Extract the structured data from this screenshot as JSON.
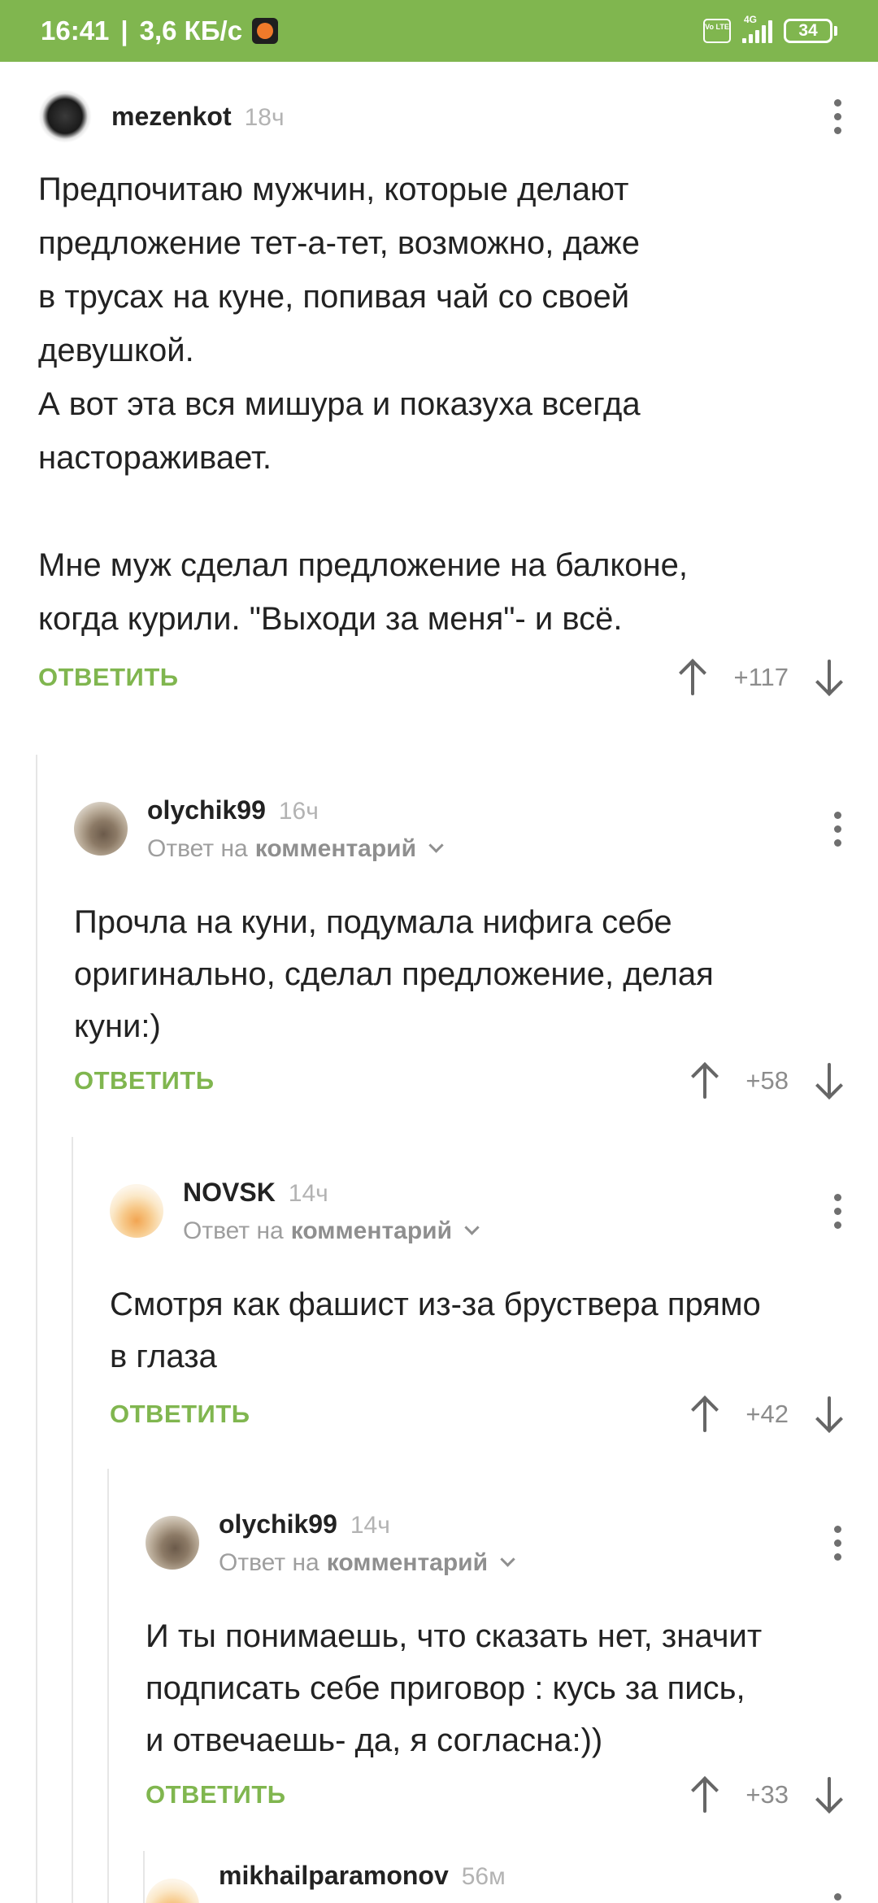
{
  "status_bar": {
    "time": "16:41",
    "speed": "3,6 КБ/с",
    "network": "4G",
    "volte": "Vo LTE",
    "battery": "34"
  },
  "accent_color": "#80b64f",
  "comments": [
    {
      "author": "mezenkot",
      "time": "18ч",
      "text": "Предпочитаю мужчин, которые делают\nпредложение тет-а-тет, возможно, даже\nв трусах на куне, попивая чай со своей\nдевушкой.\nА вот эта вся мишура и показуха всегда\nнастораживает.\n\nМне муж сделал предложение на балконе,\nкогда курили. \"Выходи за меня\"- и всё.",
      "reply_label": "ОТВЕТИТЬ",
      "score": "+117"
    },
    {
      "author": "olychik99",
      "time": "16ч",
      "reply_prefix": "Ответ на",
      "reply_target": "комментарий",
      "text": "Прочла на куни, подумала нифига себе\nоригинально, сделал предложение, делая\nкуни:)",
      "reply_label": "ОТВЕТИТЬ",
      "score": "+58"
    },
    {
      "author": "NOVSK",
      "time": "14ч",
      "reply_prefix": "Ответ на",
      "reply_target": "комментарий",
      "text": "Смотря как фашист из-за бруствера прямо\nв глаза",
      "reply_label": "ОТВЕТИТЬ",
      "score": "+42"
    },
    {
      "author": "olychik99",
      "time": "14ч",
      "reply_prefix": "Ответ на",
      "reply_target": "комментарий",
      "text": "И ты понимаешь, что сказать нет, значит\nподписать себе приговор : кусь за пись,\nи отвечаешь- да, я согласна:))",
      "reply_label": "ОТВЕТИТЬ",
      "score": "+33"
    },
    {
      "author": "mikhailparamonov",
      "time": "56м"
    }
  ]
}
